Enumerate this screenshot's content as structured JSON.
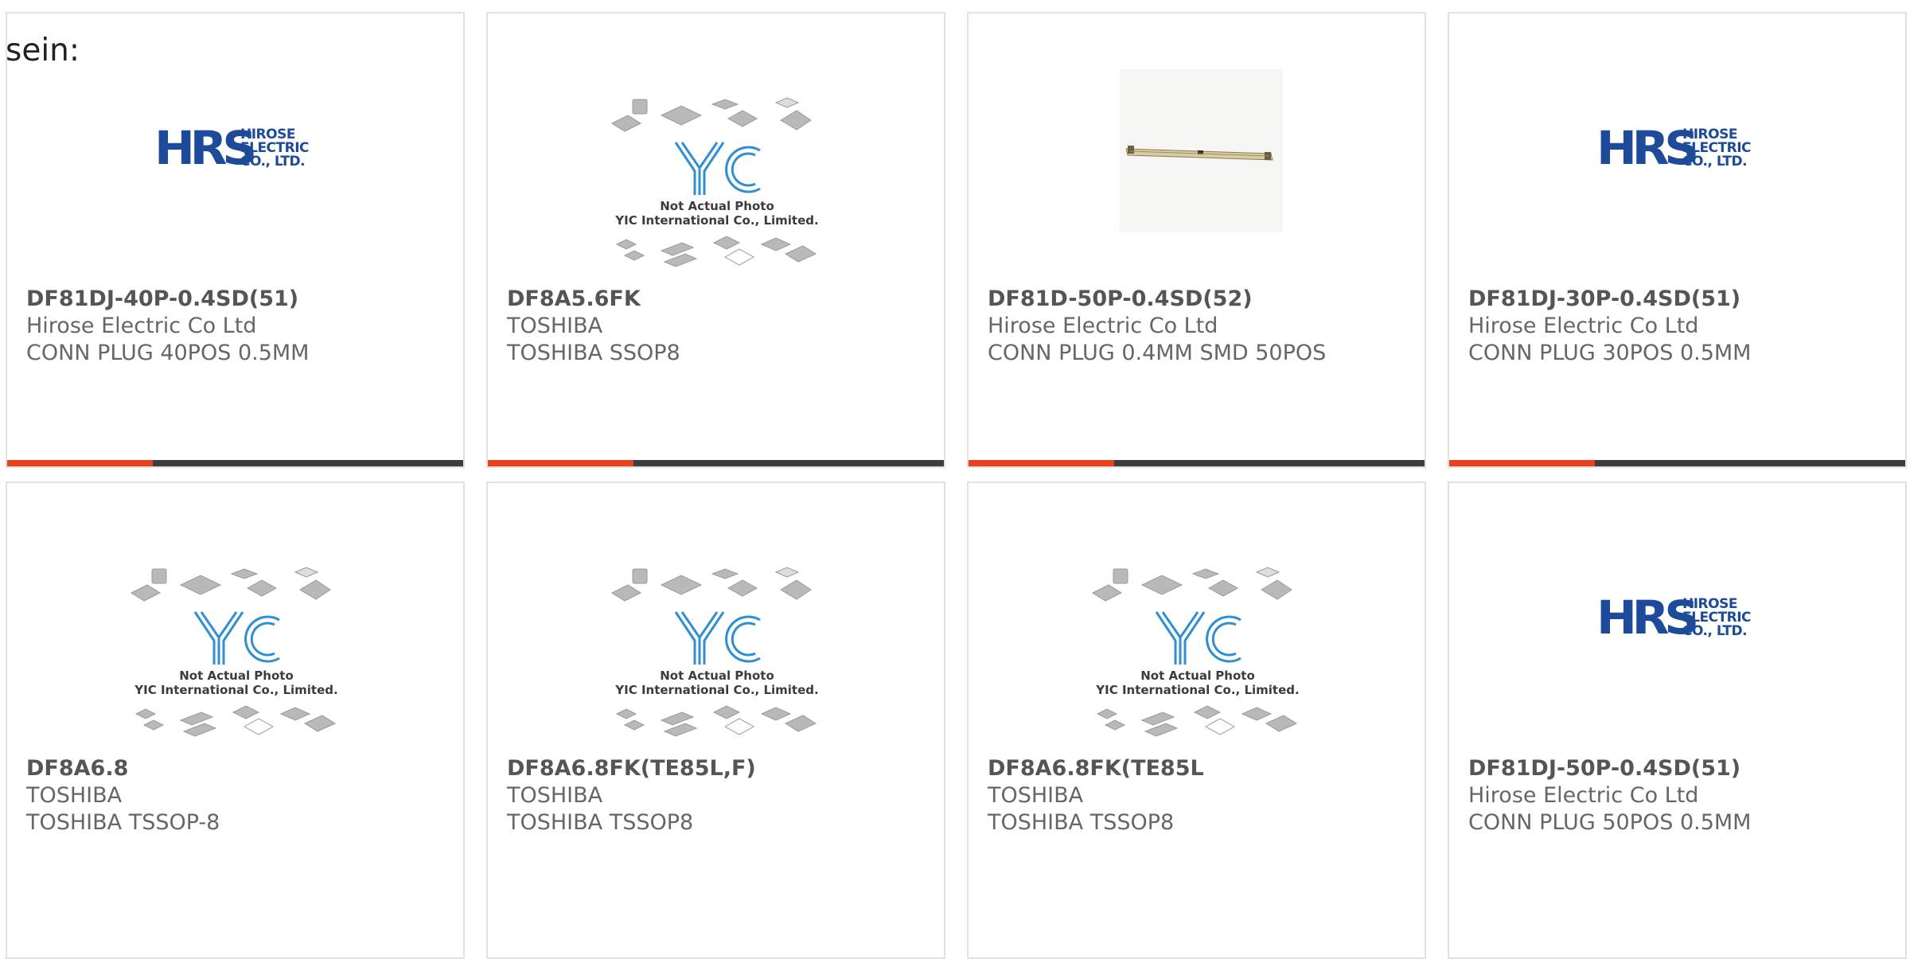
{
  "page": {
    "label": "sein:"
  },
  "products": [
    {
      "part_number": "DF81DJ-40P-0.4SD(51)",
      "manufacturer": "Hirose Electric Co Ltd",
      "description": "CONN PLUG 40POS 0.5MM",
      "image": "hrs-logo",
      "has_bar": true
    },
    {
      "part_number": "DF8A5.6FK",
      "manufacturer": "TOSHIBA",
      "description": "TOSHIBA SSOP8",
      "image": "yic-placeholder",
      "has_bar": true
    },
    {
      "part_number": "DF81D-50P-0.4SD(52)",
      "manufacturer": "Hirose Electric Co Ltd",
      "description": "CONN PLUG 0.4MM SMD 50POS",
      "image": "connector-photo",
      "has_bar": true
    },
    {
      "part_number": "DF81DJ-30P-0.4SD(51)",
      "manufacturer": "Hirose Electric Co Ltd",
      "description": "CONN PLUG 30POS 0.5MM",
      "image": "hrs-logo",
      "has_bar": true
    },
    {
      "part_number": "DF8A6.8",
      "manufacturer": "TOSHIBA",
      "description": "TOSHIBA TSSOP-8",
      "image": "yic-placeholder",
      "has_bar": false
    },
    {
      "part_number": "DF8A6.8FK(TE85L,F)",
      "manufacturer": "TOSHIBA",
      "description": "TOSHIBA TSSOP8",
      "image": "yic-placeholder",
      "has_bar": false
    },
    {
      "part_number": "DF8A6.8FK(TE85L",
      "manufacturer": "TOSHIBA",
      "description": "TOSHIBA TSSOP8",
      "image": "yic-placeholder",
      "has_bar": false
    },
    {
      "part_number": "DF81DJ-50P-0.4SD(51)",
      "manufacturer": "Hirose Electric Co Ltd",
      "description": "CONN PLUG 50POS 0.5MM",
      "image": "hrs-logo",
      "has_bar": false
    }
  ],
  "hrs_logo": {
    "mark": "HRS",
    "lines": [
      "HIROSE",
      "ELECTRIC",
      "CO., LTD."
    ]
  },
  "yic_placeholder": {
    "mark": "YIC",
    "caption_line1": "Not Actual Photo",
    "caption_line2": "YIC International Co., Limited."
  },
  "colors": {
    "accent": "#e8411d",
    "bar": "#3e3e3e",
    "hrs_blue": "#1d4a99",
    "yic_blue": "#2f8fd0",
    "text": "#666666"
  }
}
